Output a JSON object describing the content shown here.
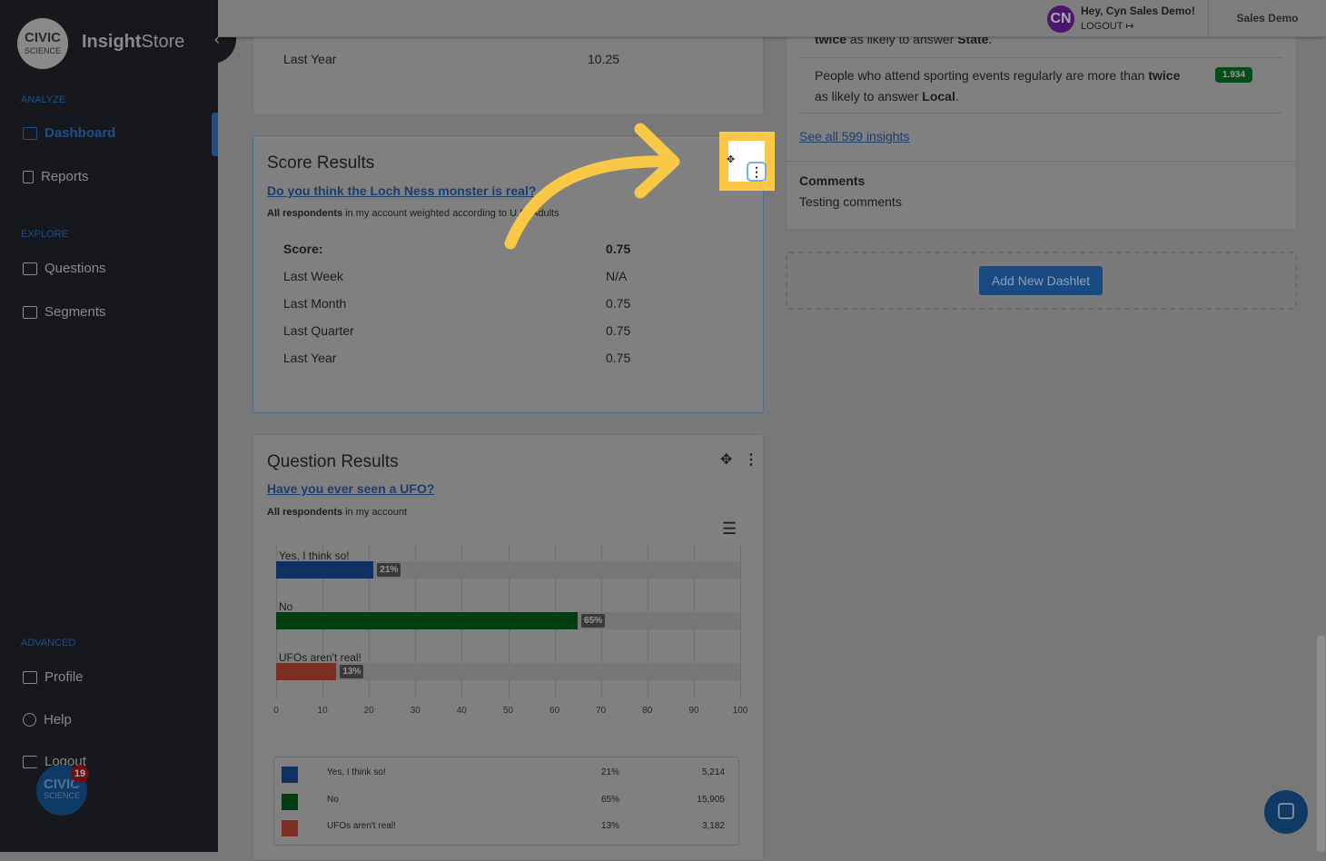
{
  "sidebar": {
    "logo": {
      "line1": "CIVIC",
      "line2": "SCIENCE"
    },
    "brand_bold": "Insight",
    "brand_rest": "Store",
    "sections": {
      "analyze": "ANALYZE",
      "explore": "EXPLORE",
      "advanced": "ADVANCED"
    },
    "items": [
      {
        "label": "Dashboard",
        "icon": "dashboard-icon",
        "active": true
      },
      {
        "label": "Reports",
        "icon": "report-icon"
      },
      {
        "label": "Questions",
        "icon": "question-icon"
      },
      {
        "label": "Segments",
        "icon": "segments-icon"
      },
      {
        "label": "Profile",
        "icon": "profile-card-icon"
      },
      {
        "label": "Help",
        "icon": "lifebuoy-icon"
      },
      {
        "label": "Logout",
        "icon": "logout-icon"
      }
    ],
    "notifications": "19"
  },
  "header": {
    "avatar": "CN",
    "greeting": "Hey, Cyn Sales Demo!",
    "logout": "LOGOUT",
    "account": "Sales Demo"
  },
  "prev_card": {
    "label": "Last Year",
    "value": "10.25"
  },
  "score": {
    "title": "Score Results",
    "question": "Do you think the Loch Ness monster is real?",
    "desc_bold": "All respondents",
    "desc": " in my account weighted according to U.S. Adults",
    "rows": [
      {
        "label": "Score:",
        "value": "0.75"
      },
      {
        "label": "Last Week",
        "value": "N/A"
      },
      {
        "label": "Last Month",
        "value": "0.75"
      },
      {
        "label": "Last Quarter",
        "value": "0.75"
      },
      {
        "label": "Last Year",
        "value": "0.75"
      }
    ]
  },
  "question": {
    "title": "Question Results",
    "question": "Have you ever seen a UFO?",
    "desc_bold": "All respondents",
    "desc": " in my account"
  },
  "chart_data": {
    "type": "bar",
    "orientation": "horizontal",
    "categories": [
      "Yes, I think so!",
      "No",
      "UFOs aren't real!"
    ],
    "values": [
      21,
      65,
      13
    ],
    "labels": [
      "21%",
      "65%",
      "13%"
    ],
    "colors": [
      "#0f3060",
      "#053d12",
      "#7a3124"
    ],
    "xlim": [
      0,
      100
    ],
    "ticks": [
      "0",
      "10",
      "20",
      "30",
      "40",
      "50",
      "60",
      "70",
      "80",
      "90",
      "100"
    ],
    "grid": true,
    "legend": [
      {
        "label": "Yes, I think so!",
        "pct": "21%",
        "count": "5,214"
      },
      {
        "label": "No",
        "pct": "65%",
        "count": "15,905"
      },
      {
        "label": "UFOs aren't real!",
        "pct": "13%",
        "count": "3,182"
      }
    ]
  },
  "insights": {
    "partial_pre": "twice",
    "partial_mid": " as likely to answer ",
    "partial_bold": "State",
    "item_text": "People who attend sporting events regularly are more than ",
    "item_bold1": "twice",
    "item_mid": " as likely to answer ",
    "item_bold2": "Local",
    "score": "1.934",
    "see_all": "See all 599 insights"
  },
  "comments": {
    "title": "Comments",
    "text": "Testing comments"
  },
  "add_dashlet": "Add New Dashlet",
  "accent": "#f9c846"
}
